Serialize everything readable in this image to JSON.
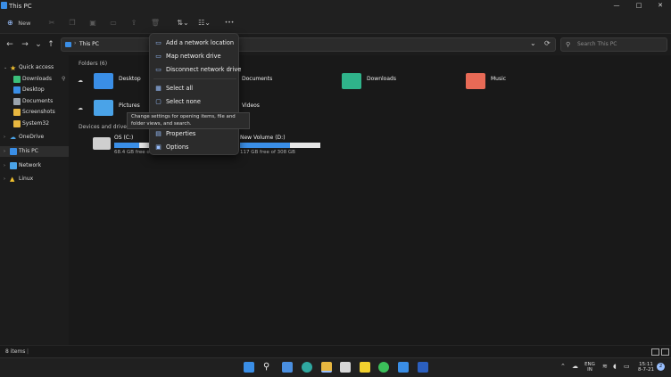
{
  "window": {
    "title": "This PC",
    "minimize": "—",
    "maximize": "□",
    "close": "✕"
  },
  "toolbar": {
    "new_label": "New",
    "sort_icon": "sort-icon",
    "view_icon": "view-icon",
    "more_label": "•••"
  },
  "nav": {
    "back": "←",
    "forward": "→",
    "recent": "⌄",
    "up": "↑",
    "refresh": "⟳",
    "dropdown": "⌄"
  },
  "address": {
    "path": "This PC"
  },
  "search": {
    "placeholder": "Search This PC"
  },
  "sidebar": {
    "quick_access": "Quick access",
    "items": [
      {
        "label": "Downloads",
        "color": "#3bbf7a"
      },
      {
        "label": "Desktop",
        "color": "#3a8ee6"
      },
      {
        "label": "Documents",
        "color": "#9aa3ad"
      },
      {
        "label": "Screenshots",
        "color": "#e8b740"
      },
      {
        "label": "System32",
        "color": "#e8b740"
      }
    ],
    "onedrive": "OneDrive",
    "this_pc": "This PC",
    "network": "Network",
    "linux": "Linux"
  },
  "main": {
    "folders_header": "Folders (6)",
    "folders": [
      {
        "label": "Desktop",
        "color": "#3a8ee6"
      },
      {
        "label": "Documents",
        "color": "#9aa3ad"
      },
      {
        "label": "Downloads",
        "color": "#2fb38a"
      },
      {
        "label": "Music",
        "color": "#e86a56"
      },
      {
        "label": "Pictures",
        "color": "#4aa3e8"
      },
      {
        "label": "Videos",
        "color": "#8e5ce6"
      }
    ],
    "drives_header": "Devices and drives (",
    "drives": [
      {
        "name": "OS (C:)",
        "free": "68.4 GB free o",
        "used_fraction": 0.7
      },
      {
        "name": "New Volume (D:)",
        "free": "117 GB free of 308 GB",
        "used_fraction": 0.62
      }
    ]
  },
  "menu": {
    "items": [
      {
        "label": "Add a network location",
        "icon": "▭"
      },
      {
        "label": "Map network drive",
        "icon": "▭"
      },
      {
        "label": "Disconnect network drive",
        "icon": "▭"
      },
      {
        "label": "Select all",
        "icon": "▦"
      },
      {
        "label": "Select none",
        "icon": "▢"
      },
      {
        "label": "Properties",
        "icon": "▤"
      },
      {
        "label": "Options",
        "icon": "▣"
      }
    ]
  },
  "tooltip": {
    "text": "Change settings for opening items, file and folder views, and search."
  },
  "status": {
    "count": "8 items",
    "sep": "|"
  },
  "taskbar": {
    "lang1": "ENG",
    "lang2": "IN",
    "time": "15:11",
    "date": "8-7-21",
    "notif": "2"
  }
}
